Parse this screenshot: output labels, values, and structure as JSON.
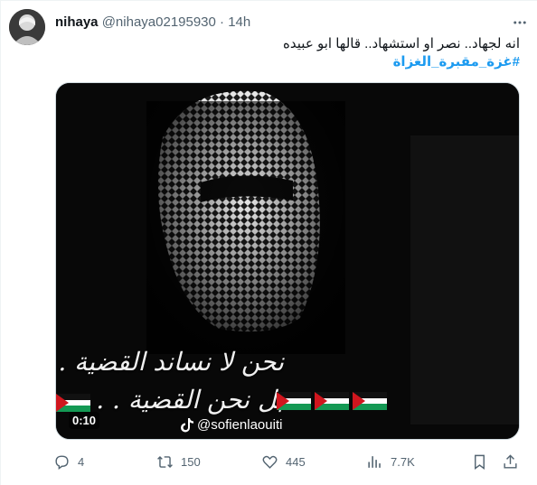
{
  "author": {
    "name": "nihaya",
    "handle": "@nihaya02195930",
    "separator": "·",
    "time": "14h"
  },
  "tweet": {
    "line1": "انه لجهاد.. نصر او استشهاد.. قالها ابو عبيده",
    "hashtag": "#غزة_مقبرة_الغزاة"
  },
  "video": {
    "overlay_line1": "نحن لا نساند القضية . .",
    "overlay_line2": "بل نحن القضية . .",
    "duration": "0:10",
    "watermark": "@sofienlaouiti"
  },
  "actions": {
    "replies": "4",
    "reposts": "150",
    "likes": "445",
    "views": "7.7K"
  },
  "icons": {
    "more": "more-horizontal-icon",
    "reply": "reply-icon",
    "repost": "repost-icon",
    "like": "heart-icon",
    "views": "views-icon",
    "bookmark": "bookmark-icon",
    "share": "share-icon",
    "tiktok": "tiktok-logo-icon"
  },
  "colors": {
    "accent": "#1d9bf0",
    "text": "#0f1419",
    "secondary": "#536471",
    "flag_red": "#d0161e",
    "flag_green": "#149954"
  }
}
